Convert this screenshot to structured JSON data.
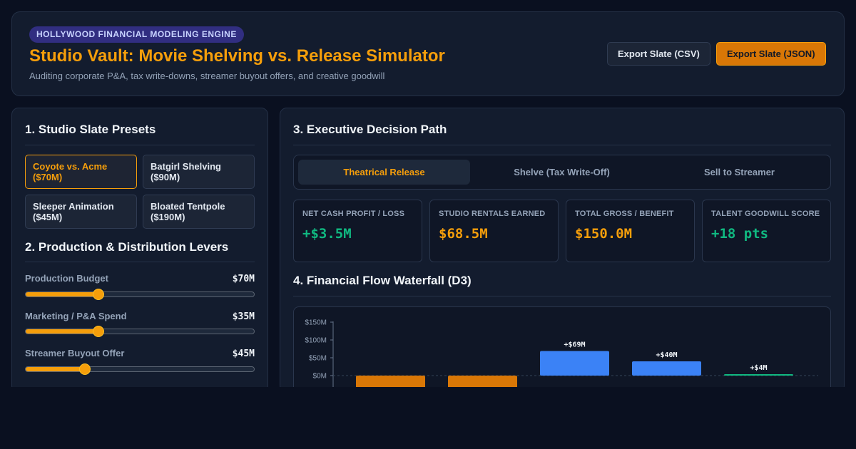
{
  "header": {
    "badge": "HOLLYWOOD FINANCIAL MODELING ENGINE",
    "title": "Studio Vault: Movie Shelving vs. Release Simulator",
    "subtitle": "Auditing corporate P&A, tax write-downs, streamer buyout offers, and creative goodwill",
    "export_csv": "Export Slate (CSV)",
    "export_json": "Export Slate (JSON)"
  },
  "presets": {
    "title": "1. Studio Slate Presets",
    "items": [
      {
        "name": "Coyote vs. Acme",
        "budget": "($70M)"
      },
      {
        "name": "Batgirl Shelving",
        "budget": "($90M)"
      },
      {
        "name": "Sleeper Animation",
        "budget": "($45M)"
      },
      {
        "name": "Bloated Tentpole",
        "budget": "($190M)"
      }
    ]
  },
  "levers": {
    "title": "2. Production & Distribution Levers",
    "items": [
      {
        "label": "Production Budget",
        "value": "$70M",
        "fraction": 0.32
      },
      {
        "label": "Marketing / P&A Spend",
        "value": "$35M",
        "fraction": 0.32
      },
      {
        "label": "Streamer Buyout Offer",
        "value": "$45M",
        "fraction": 0.26
      }
    ]
  },
  "decision": {
    "title": "3. Executive Decision Path",
    "tabs": [
      "Theatrical Release",
      "Shelve (Tax Write-Off)",
      "Sell to Streamer"
    ],
    "active_tab": 0
  },
  "kpis": [
    {
      "label": "NET CASH PROFIT / LOSS",
      "value": "+$3.5M",
      "color": "#10b981"
    },
    {
      "label": "STUDIO RENTALS EARNED",
      "value": "$68.5M",
      "color": "#f59e0b"
    },
    {
      "label": "TOTAL GROSS / BENEFIT",
      "value": "$150.0M",
      "color": "#f59e0b"
    },
    {
      "label": "TALENT GOODWILL SCORE",
      "value": "+18 pts",
      "color": "#10b981"
    }
  ],
  "waterfall": {
    "title": "4. Financial Flow Waterfall (D3)"
  },
  "chart_data": {
    "type": "bar",
    "y_ticks": [
      "$150M",
      "$100M",
      "$50M",
      "$0M"
    ],
    "ylim": [
      -150,
      150
    ],
    "bars": [
      {
        "value": -70,
        "label": "",
        "color": "#d97706"
      },
      {
        "value": -35,
        "label": "",
        "color": "#d97706"
      },
      {
        "value": 69,
        "label": "+$69M",
        "color": "#3b82f6"
      },
      {
        "value": 40,
        "label": "+$40M",
        "color": "#3b82f6"
      },
      {
        "value": 4,
        "label": "+$4M",
        "color": "#10b981"
      }
    ]
  }
}
